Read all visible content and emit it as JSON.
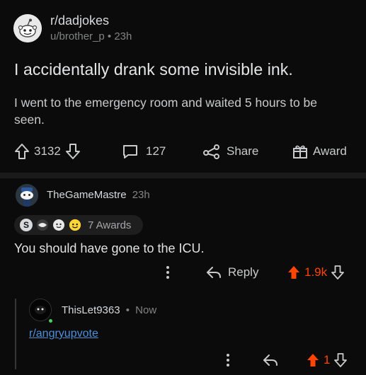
{
  "post": {
    "subreddit": "r/dadjokes",
    "author": "u/brother_p",
    "separator": "•",
    "age": "23h",
    "title": "I accidentally drank some invisible ink.",
    "body": "I went to the emergency room and waited 5 hours to be seen.",
    "score": "3132",
    "comments": "127",
    "share_label": "Share",
    "award_label": "Award"
  },
  "comment1": {
    "author": "TheGameMastre",
    "age": "23h",
    "awards_label": "7 Awards",
    "award_letter": "S",
    "body": "You should have gone to the ICU.",
    "reply_label": "Reply",
    "score": "1.9k"
  },
  "comment2": {
    "author": "ThisLet9363",
    "separator": "•",
    "age": "Now",
    "link_text": "r/angryupvote",
    "score": "1"
  },
  "colors": {
    "background": "#0b0b0b",
    "upvote": "#ff4500",
    "link": "#4f8fd8",
    "muted": "#818384",
    "online": "#46d160"
  },
  "icons": [
    "upvote-arrow-icon",
    "downvote-arrow-icon",
    "comment-bubble-icon",
    "share-icon",
    "gift-icon",
    "more-dots-icon",
    "reply-arrow-icon"
  ]
}
